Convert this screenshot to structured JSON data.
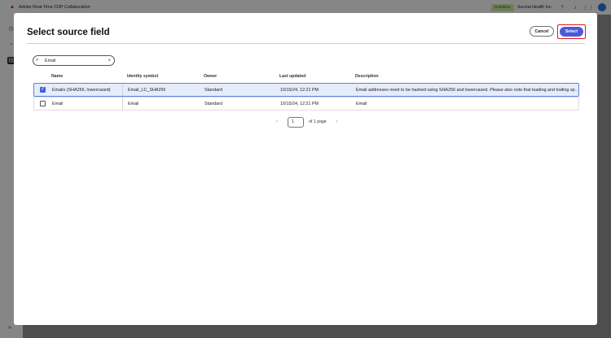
{
  "app": {
    "title": "Adobe Real-Time CDP Collaboration",
    "role_badge": "Publisher",
    "org_name": "Surreal Health Inc."
  },
  "modal": {
    "title": "Select source field",
    "cancel_label": "Cancel",
    "select_label": "Select"
  },
  "search": {
    "value": "Email",
    "clear_icon": "×"
  },
  "table": {
    "columns": [
      "Name",
      "Identity symbol",
      "Owner",
      "Last updated",
      "Description"
    ],
    "rows": [
      {
        "checked": true,
        "name": "Emails (SHA256, lowercased)",
        "identity": "Email_LC_SHA256",
        "owner": "Standard",
        "updated": "10/15/24, 12:21 PM",
        "description": "Email addresses need to be hashed using SHA256 and lowercased. Please also note that leading and trailing sp..."
      },
      {
        "checked": false,
        "name": "Email",
        "identity": "Email",
        "owner": "Standard",
        "updated": "10/15/24, 12:21 PM",
        "description": "Email"
      }
    ]
  },
  "pagination": {
    "page": "1",
    "of_label": "of 1 page"
  },
  "icons": {
    "search": "search-icon",
    "help": "help-icon",
    "bell": "bell-icon",
    "apps": "apps-grid-icon"
  },
  "colors": {
    "accent": "#4b59d8",
    "highlight": "#e0191b",
    "selected_row": "#e5ecfb"
  }
}
